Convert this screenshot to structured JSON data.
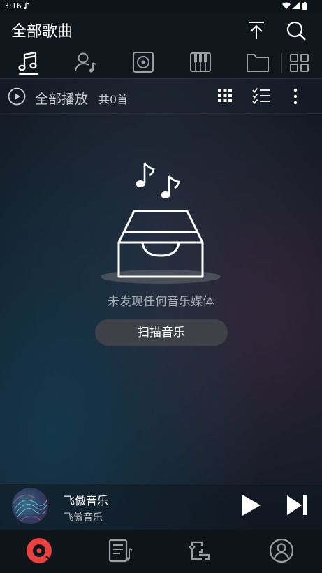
{
  "status_bar": {
    "time": "3:16"
  },
  "header": {
    "title": "全部歌曲"
  },
  "tabs": [
    {
      "icon": "music-note-icon",
      "active": true
    },
    {
      "icon": "artist-icon",
      "active": false
    },
    {
      "icon": "album-icon",
      "active": false
    },
    {
      "icon": "piano-icon",
      "active": false
    },
    {
      "icon": "folder-icon",
      "active": false
    },
    {
      "icon": "grid-icon",
      "active": false
    }
  ],
  "actions": {
    "play_all_label": "全部播放",
    "count_label": "共0首"
  },
  "empty_state": {
    "message": "未发现任何音乐媒体",
    "scan_button": "扫描音乐"
  },
  "mini_player": {
    "title": "飞傲音乐",
    "artist": "飞傲音乐"
  },
  "bottom_nav": [
    {
      "icon": "vinyl-icon",
      "active": true,
      "accent": "#e8413f"
    },
    {
      "icon": "playlist-icon",
      "active": false
    },
    {
      "icon": "switch-icon",
      "active": false
    },
    {
      "icon": "profile-icon",
      "active": false
    }
  ]
}
